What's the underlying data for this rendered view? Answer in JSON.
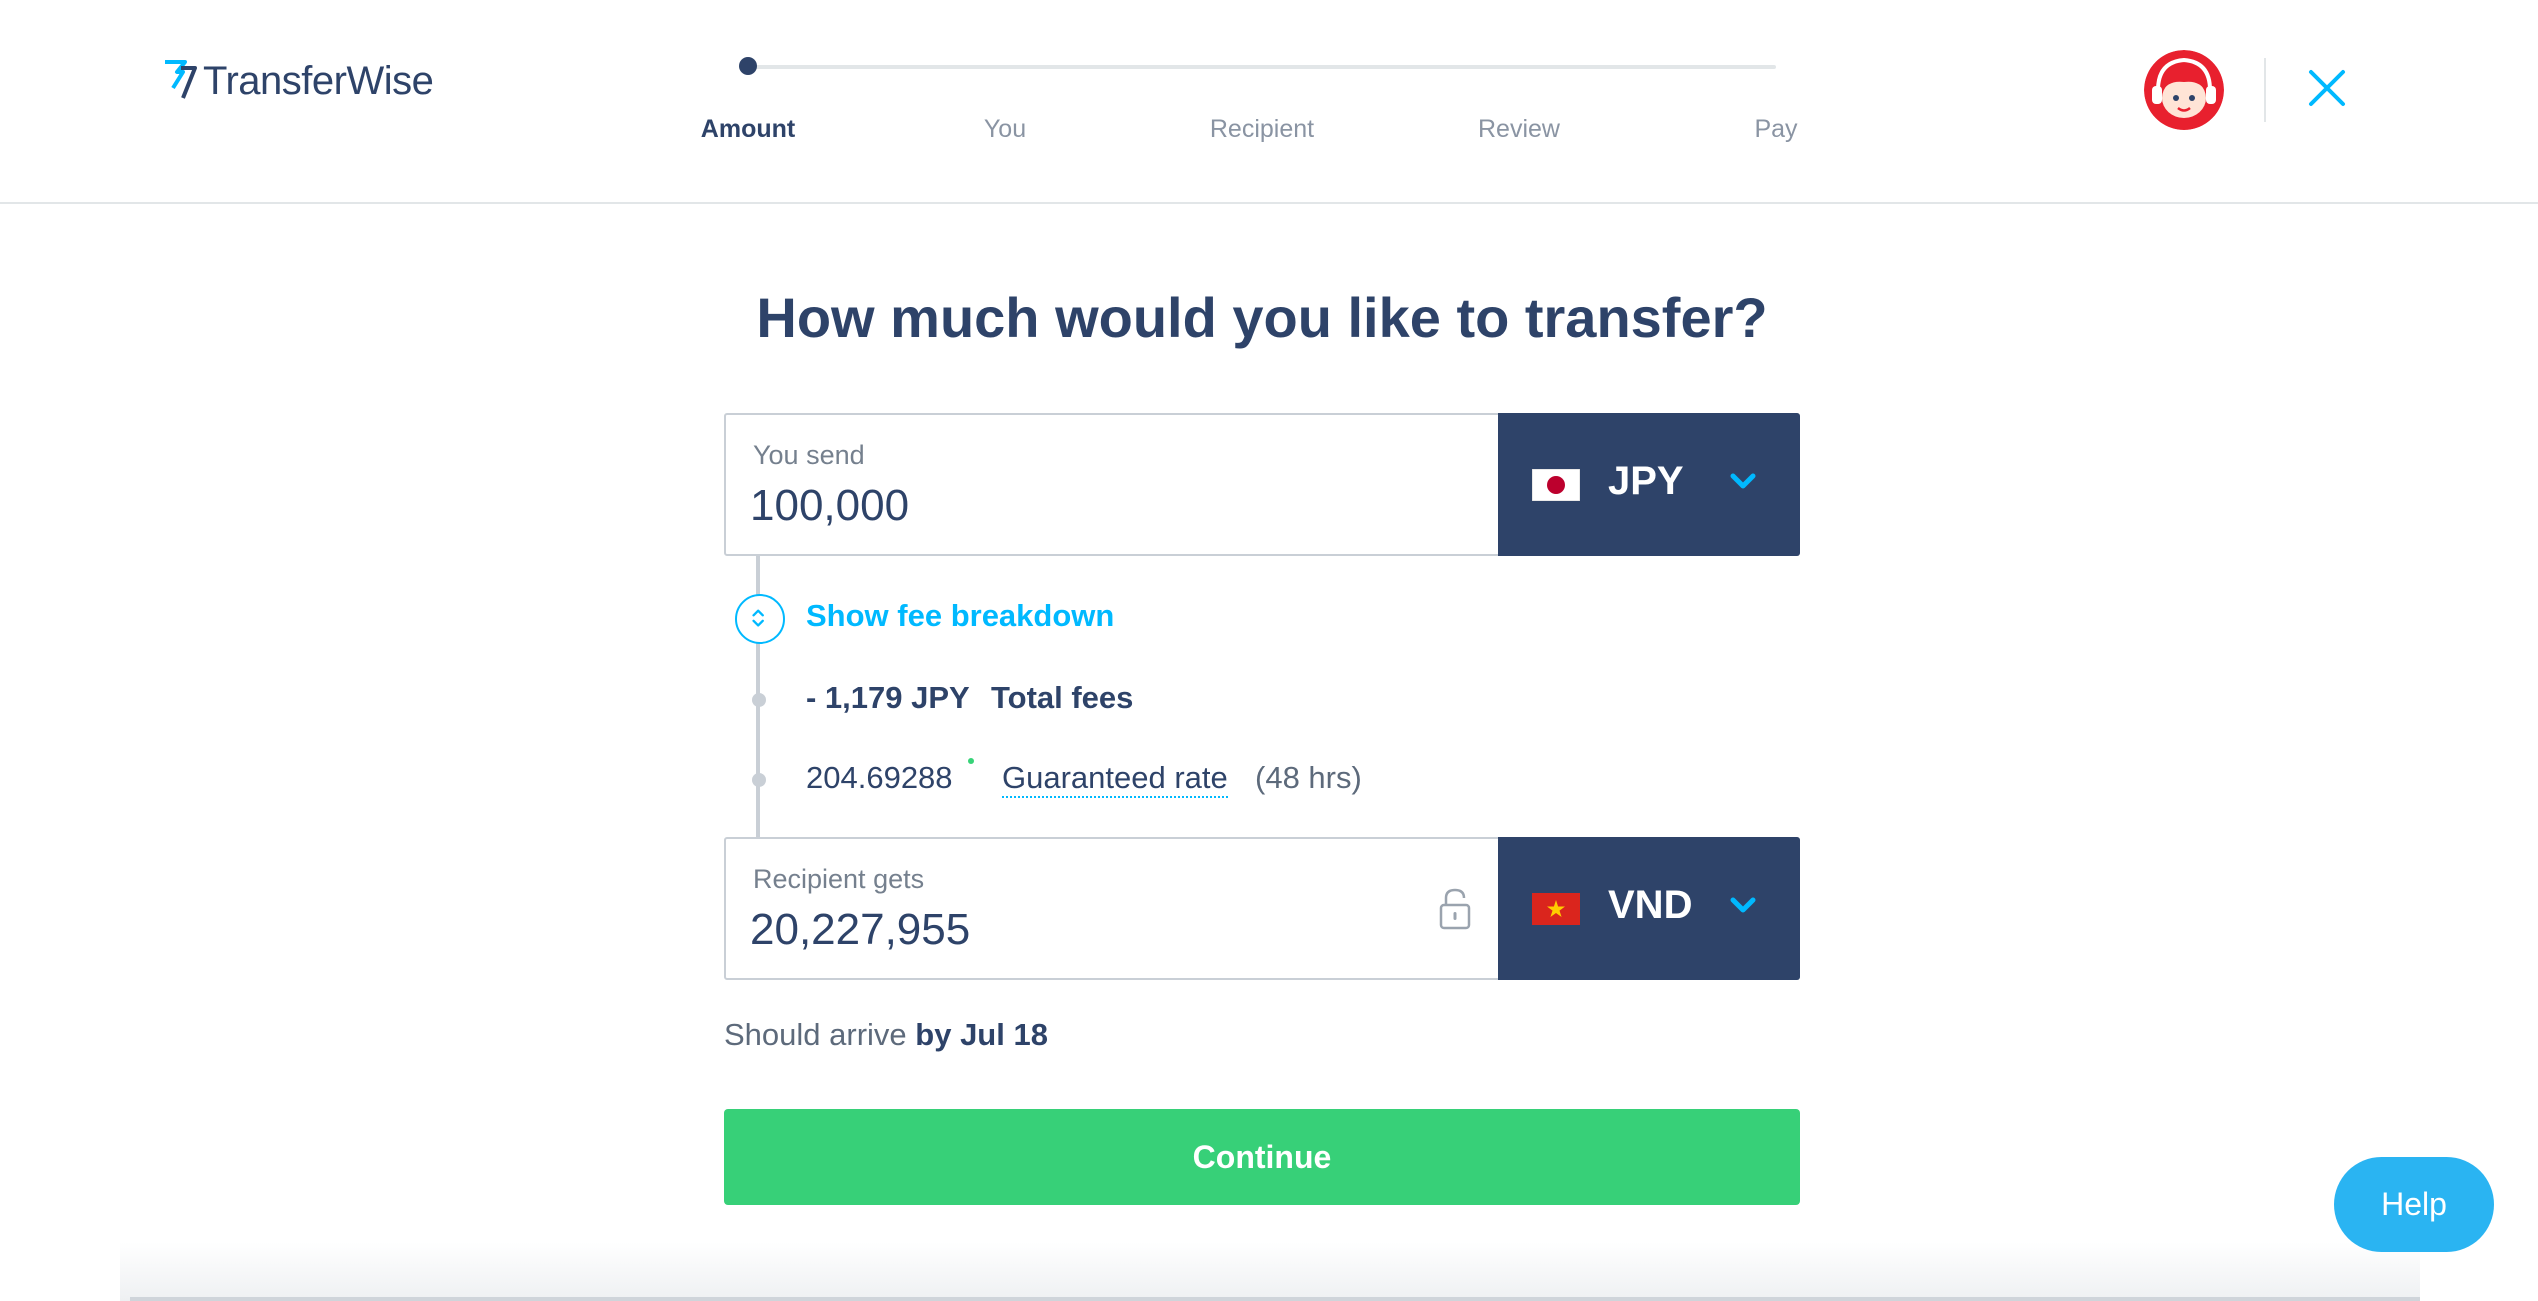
{
  "header": {
    "logo_text": "TransferWise",
    "steps": [
      {
        "label": "Amount",
        "active": true
      },
      {
        "label": "You",
        "active": false
      },
      {
        "label": "Recipient",
        "active": false
      },
      {
        "label": "Review",
        "active": false
      },
      {
        "label": "Pay",
        "active": false
      }
    ],
    "progress_fraction": 0
  },
  "main": {
    "title": "How much would you like to transfer?",
    "send": {
      "label": "You send",
      "value": "100,000",
      "currency": "JPY",
      "flag": "japan-flag-icon"
    },
    "fee_breakdown": {
      "toggle_label": "Show fee breakdown",
      "fee_amount": "- 1,179 JPY",
      "fee_label": "Total fees",
      "rate_value": "204.69288",
      "rate_link": "Guaranteed rate",
      "rate_note": "(48 hrs)"
    },
    "receive": {
      "label": "Recipient gets",
      "value": "20,227,955",
      "currency": "VND",
      "flag": "vietnam-flag-icon"
    },
    "arrival": {
      "prefix": "Should arrive",
      "date": "by Jul 18"
    },
    "continue_label": "Continue"
  },
  "help_label": "Help",
  "colors": {
    "navy": "#2e4369",
    "accent_blue": "#00b9ff",
    "continue_green": "#37d078",
    "help_blue": "#2ab4f2"
  }
}
